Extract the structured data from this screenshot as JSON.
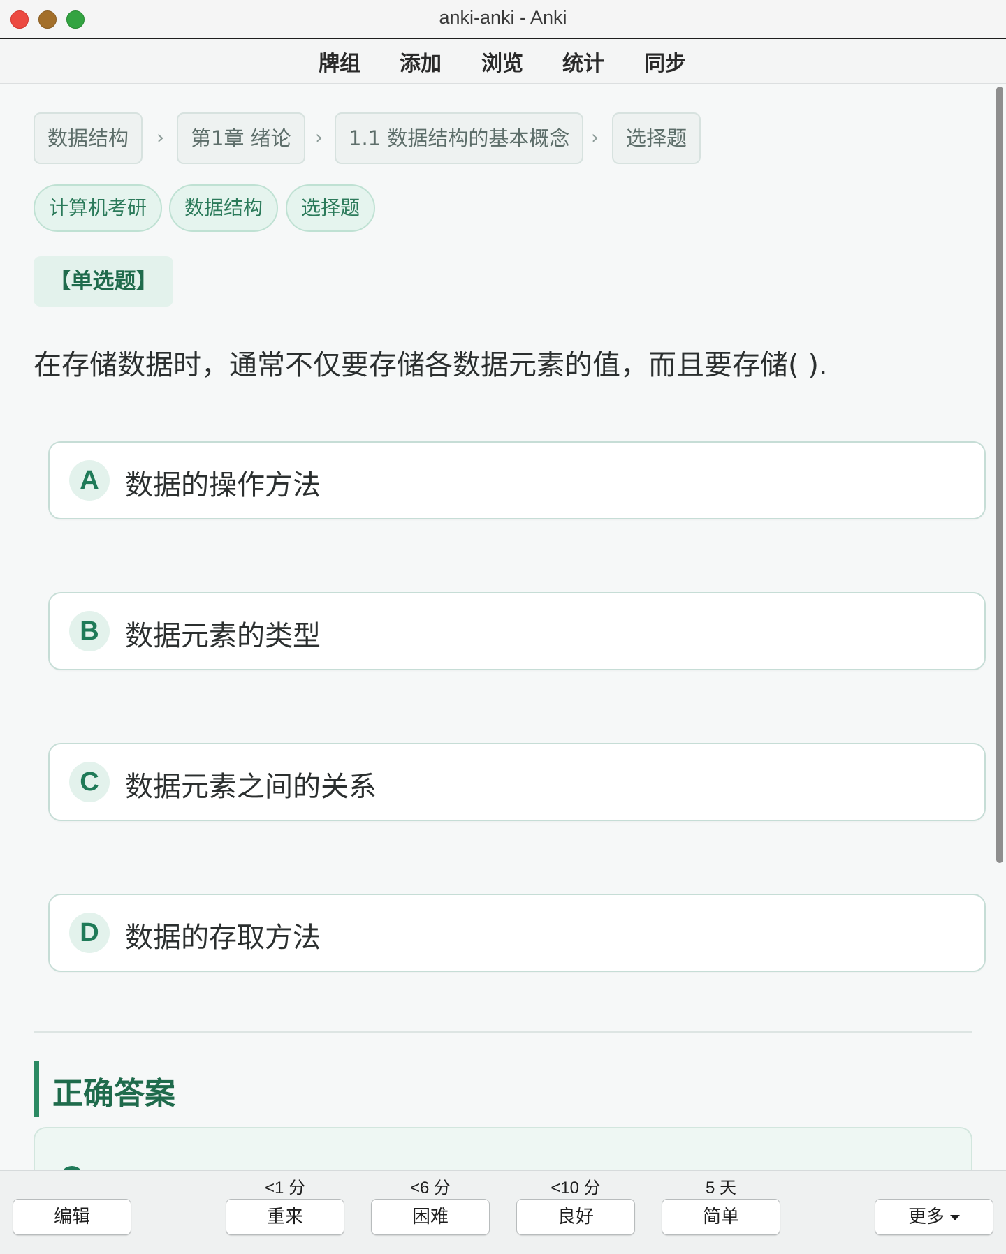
{
  "window": {
    "title": "anki-anki - Anki"
  },
  "toolbar": {
    "items": [
      "牌组",
      "添加",
      "浏览",
      "统计",
      "同步"
    ]
  },
  "breadcrumb": [
    "数据结构",
    "第1章 绪论",
    "1.1 数据结构的基本概念",
    "选择题"
  ],
  "breadcrumb_separator": "›",
  "tags": [
    "计算机考研",
    "数据结构",
    "选择题"
  ],
  "question": {
    "type": "【单选题】",
    "text": "在存储数据时，通常不仅要存储各数据元素的值，而且要存储( )."
  },
  "options": [
    {
      "letter": "A",
      "text": "数据的操作方法"
    },
    {
      "letter": "B",
      "text": "数据元素的类型"
    },
    {
      "letter": "C",
      "text": "数据元素之间的关系"
    },
    {
      "letter": "D",
      "text": "数据的存取方法"
    }
  ],
  "answer": {
    "title": "正确答案"
  },
  "bottombar": {
    "edit": "编辑",
    "more": "更多",
    "intervals": [
      "<1 分",
      "<6 分",
      "<10 分",
      "5 天"
    ],
    "buttons": [
      "重来",
      "困难",
      "良好",
      "简单"
    ]
  },
  "colors": {
    "accent": "#1f7a58",
    "tag_bg": "#e5f4ee",
    "close": "#ec4a41",
    "minimize": "#a36f2a",
    "maximize": "#33a341"
  }
}
